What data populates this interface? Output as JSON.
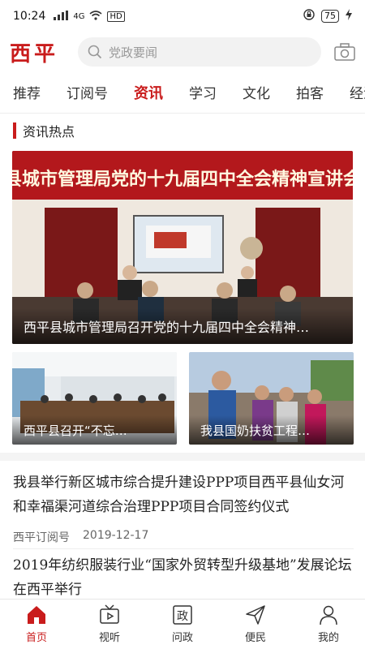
{
  "status": {
    "time": "10:24",
    "signal": "4G",
    "network": "HD",
    "battery": "75"
  },
  "header": {
    "logo": "西平",
    "search_placeholder": "党政要闻"
  },
  "tabs": [
    "推荐",
    "订阅号",
    "资讯",
    "学习",
    "文化",
    "拍客",
    "经济"
  ],
  "active_tab_index": 2,
  "section": {
    "title": "资讯热点"
  },
  "hero": {
    "banner_text": "县城市管理局党的十九届四中全会精神宣讲会",
    "caption": "西平县城市管理局召开党的十九届四中全会精神…"
  },
  "thumbs": [
    {
      "caption": "西平县召开“不忘…"
    },
    {
      "caption": "我县国奶扶贫工程…"
    }
  ],
  "articles": [
    {
      "title": "我县举行新区城市综合提升建设PPP项目西平县仙女河和幸福渠河道综合治理PPP项目合同签约仪式",
      "source": "西平订阅号",
      "date": "2019-12-17"
    },
    {
      "title": "2019年纺织服装行业“国家外贸转型升级基地”发展论坛在西平举行"
    }
  ],
  "bottom_nav": [
    {
      "label": "首页",
      "icon": "home-icon"
    },
    {
      "label": "视听",
      "icon": "tv-icon"
    },
    {
      "label": "问政",
      "icon": "zheng-icon"
    },
    {
      "label": "便民",
      "icon": "send-icon"
    },
    {
      "label": "我的",
      "icon": "user-icon"
    }
  ],
  "colors": {
    "accent": "#c91c1c"
  }
}
